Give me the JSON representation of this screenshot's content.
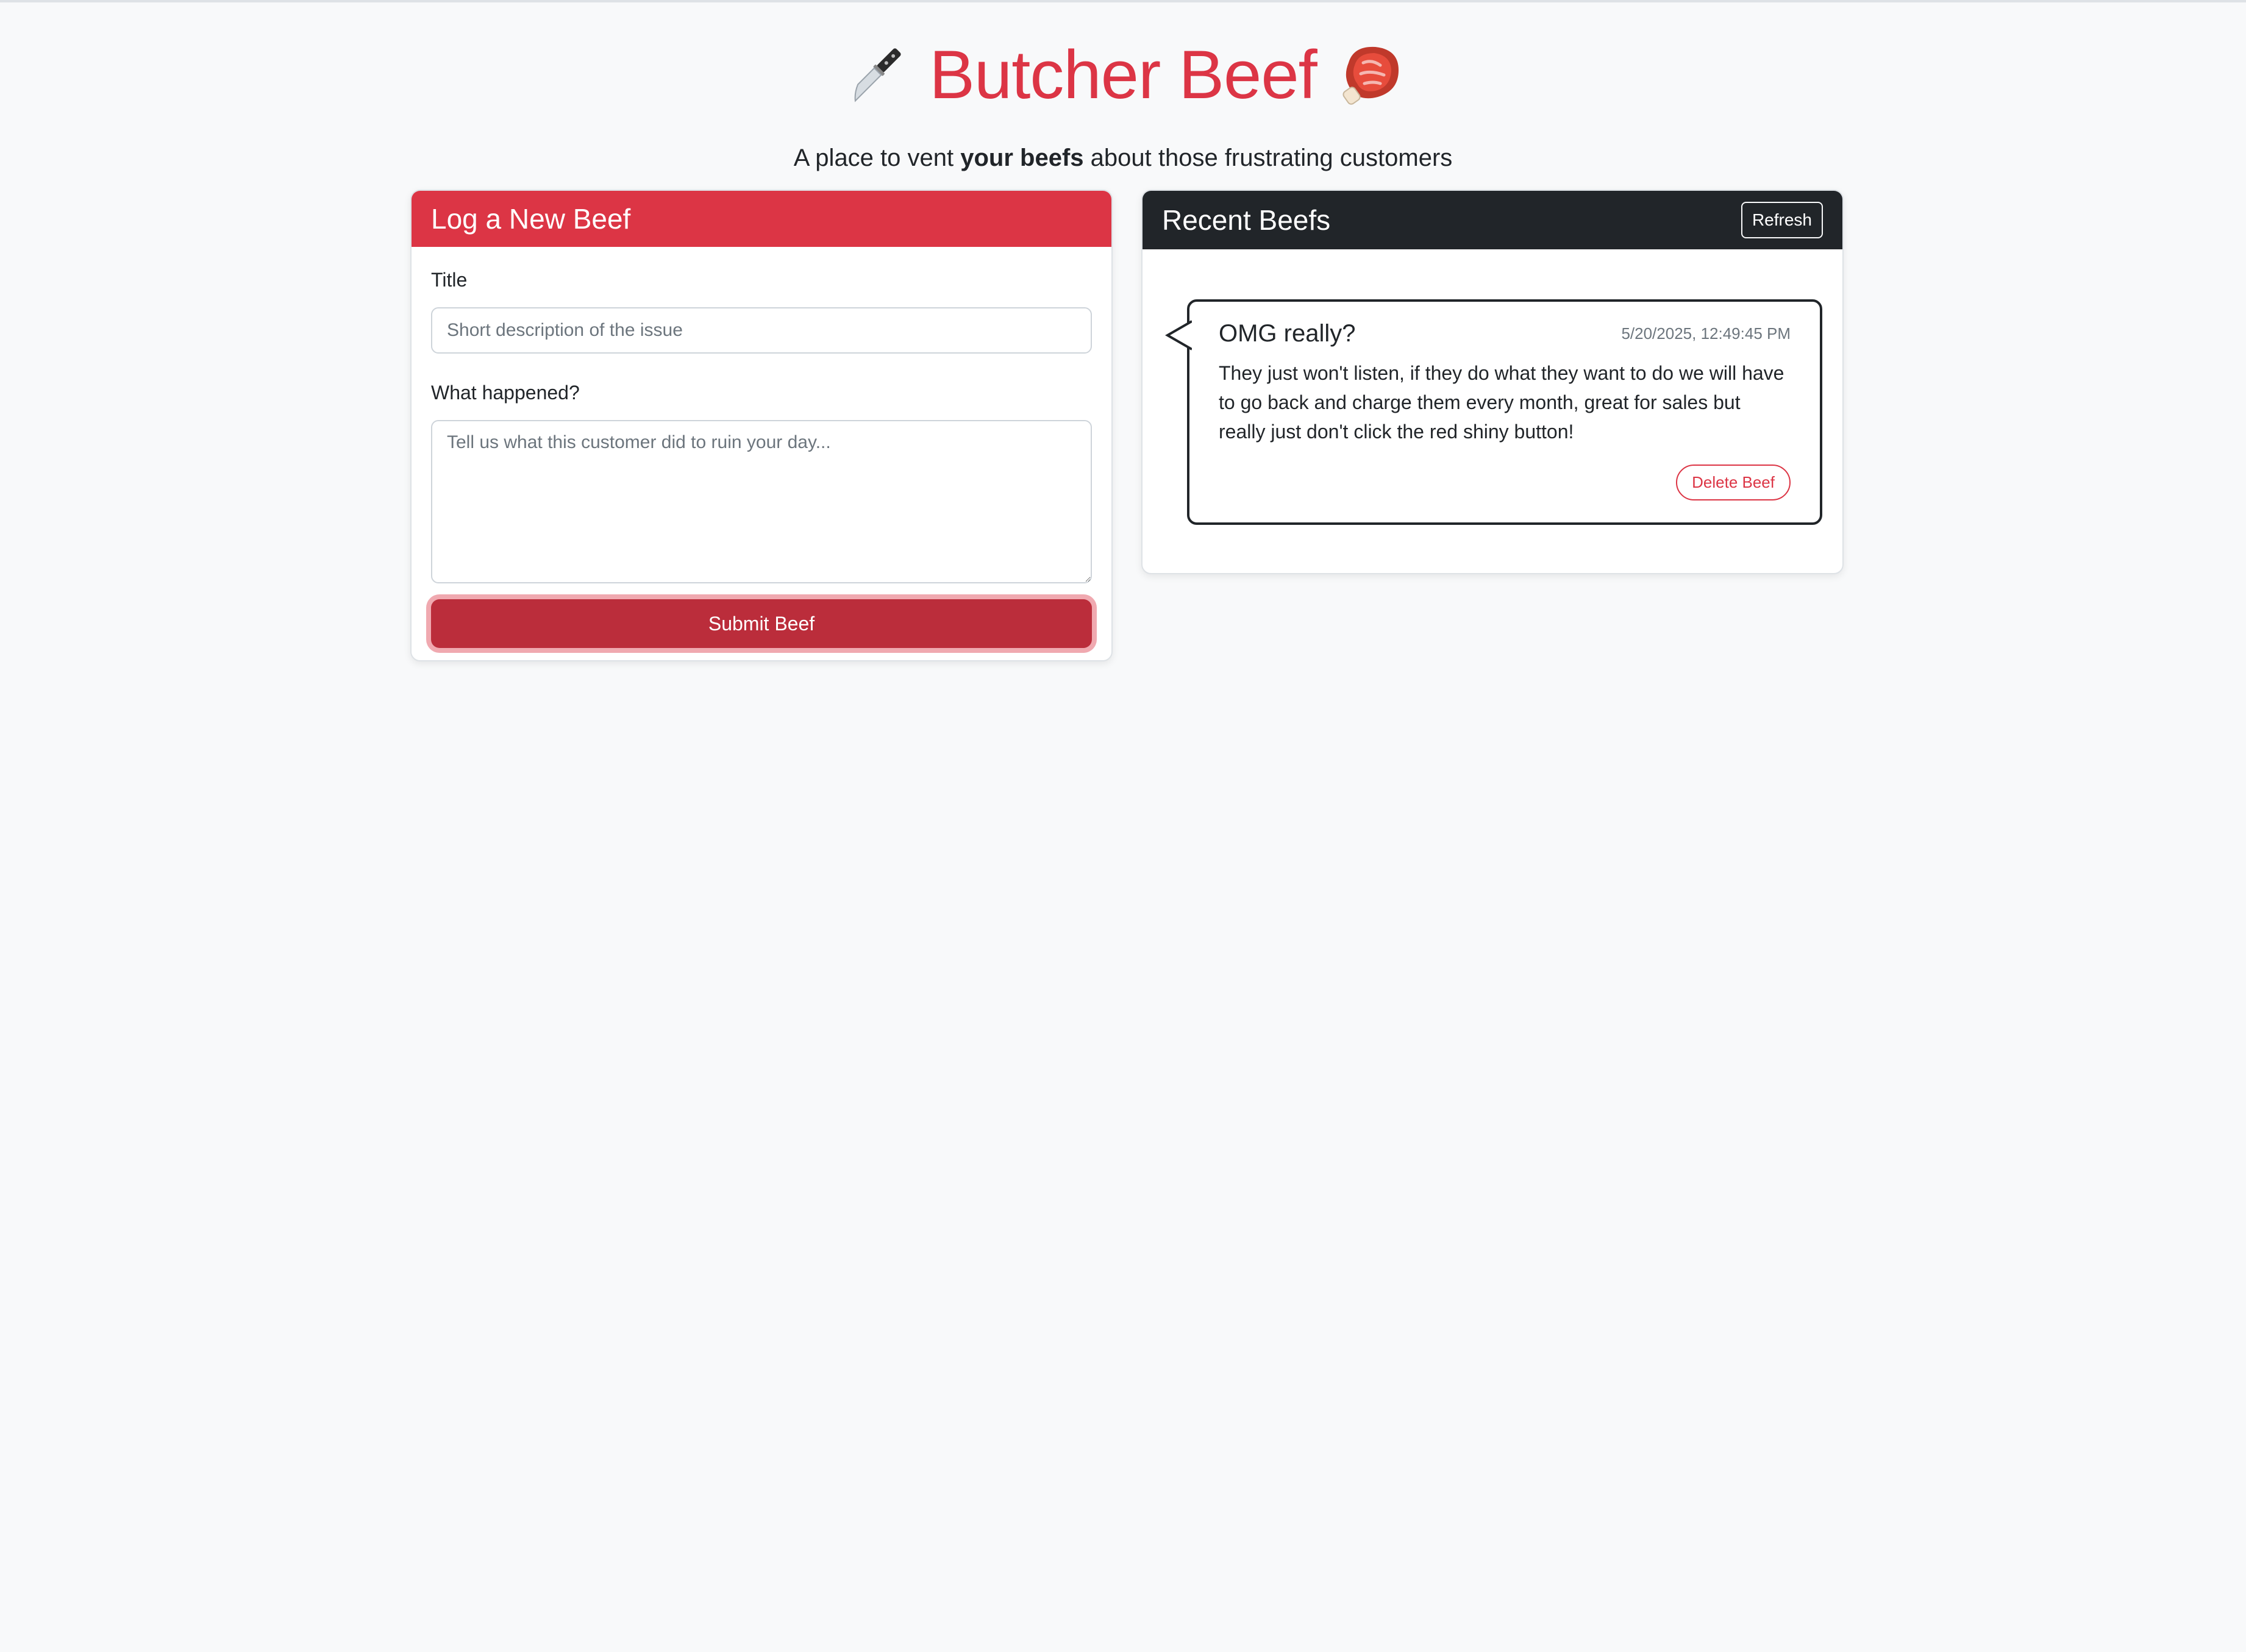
{
  "app": {
    "title": "Butcher Beef",
    "subtitle_prefix": "A place to vent ",
    "subtitle_strong": "your beefs",
    "subtitle_suffix": " about those frustrating customers",
    "accent_color": "#dc3545",
    "icons": [
      "knife-icon",
      "meat-icon"
    ]
  },
  "form": {
    "header": "Log a New Beef",
    "title_label": "Title",
    "title_placeholder": "Short description of the issue",
    "title_value": "",
    "body_label": "What happened?",
    "body_placeholder": "Tell us what this customer did to ruin your day...",
    "body_value": "",
    "submit_label": "Submit Beef"
  },
  "recent": {
    "header": "Recent Beefs",
    "refresh_label": "Refresh",
    "items": [
      {
        "title": "OMG really?",
        "timestamp": "5/20/2025, 12:49:45 PM",
        "body": "They just won't listen, if they do what they want to do we will have to go back and charge them every month, great for sales but really just don't click the red shiny button!",
        "delete_label": "Delete Beef"
      }
    ]
  }
}
